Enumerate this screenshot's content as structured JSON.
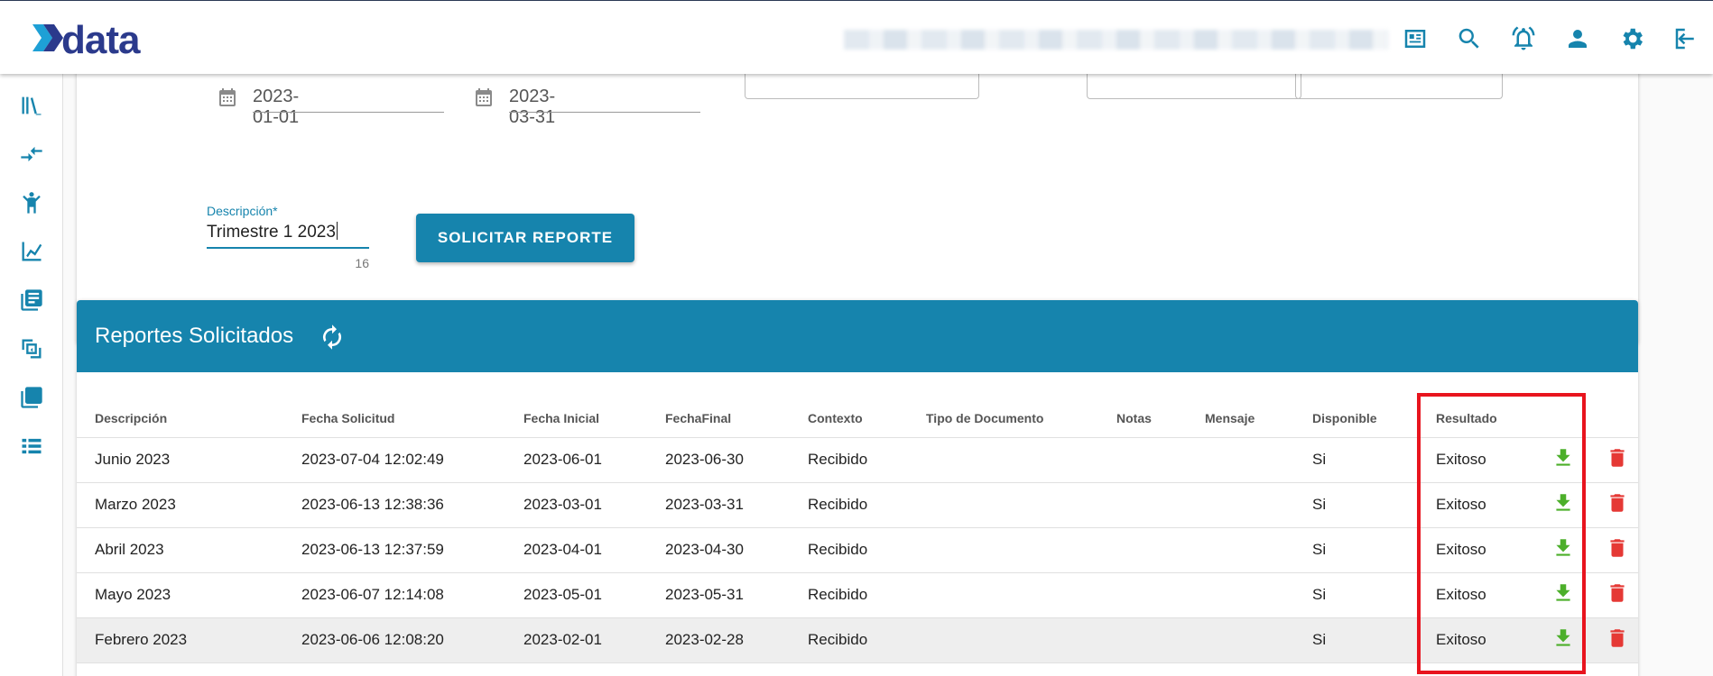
{
  "header": {
    "logo_text": "xdata",
    "icons": [
      "news-icon",
      "search-icon",
      "bell-icon",
      "user-icon",
      "gear-icon",
      "logout-icon"
    ]
  },
  "sidebar": {
    "icons": [
      "library-icon",
      "compare-arrows-icon",
      "person-icon",
      "chart-icon",
      "book-icon",
      "convert-icon",
      "stack-icon",
      "list-icon"
    ]
  },
  "form": {
    "start_date": "2023-01-01",
    "end_date": "2023-03-31",
    "description_label": "Descripción*",
    "description_value": "Trimestre 1 2023",
    "description_counter": "16",
    "submit_label": "SOLICITAR REPORTE"
  },
  "reports": {
    "title": "Reportes Solicitados",
    "columns": [
      "Descripción",
      "Fecha Solicitud",
      "Fecha Inicial",
      "FechaFinal",
      "Contexto",
      "Tipo de Documento",
      "Notas",
      "Mensaje",
      "Disponible",
      "Resultado"
    ],
    "rows": [
      [
        "Junio 2023",
        "2023-07-04 12:02:49",
        "2023-06-01",
        "2023-06-30",
        "Recibido",
        "",
        "",
        "",
        "Si",
        "Exitoso"
      ],
      [
        "Marzo 2023",
        "2023-06-13 12:38:36",
        "2023-03-01",
        "2023-03-31",
        "Recibido",
        "",
        "",
        "",
        "Si",
        "Exitoso"
      ],
      [
        "Abril 2023",
        "2023-06-13 12:37:59",
        "2023-04-01",
        "2023-04-30",
        "Recibido",
        "",
        "",
        "",
        "Si",
        "Exitoso"
      ],
      [
        "Mayo 2023",
        "2023-06-07 12:14:08",
        "2023-05-01",
        "2023-05-31",
        "Recibido",
        "",
        "",
        "",
        "Si",
        "Exitoso"
      ],
      [
        "Febrero 2023",
        "2023-06-06 12:08:20",
        "2023-02-01",
        "2023-02-28",
        "Recibido",
        "",
        "",
        "",
        "Si",
        "Exitoso"
      ]
    ]
  },
  "colors": {
    "accent": "#1684ad",
    "download": "#4caf2a",
    "delete": "#e53935",
    "highlight": "#e8141e"
  }
}
